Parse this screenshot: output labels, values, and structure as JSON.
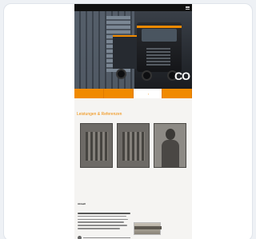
{
  "brand": {
    "logo_text": "",
    "accent": "#f08a00",
    "bar_color": "#111111"
  },
  "hero": {
    "mark_text": "CO"
  },
  "tabs": [
    {
      "label": ""
    },
    {
      "label": ""
    },
    {
      "label": ""
    },
    {
      "label": ""
    }
  ],
  "section": {
    "title": "Leistungen & Referenzen"
  },
  "gallery": [
    {
      "caption": ""
    },
    {
      "caption": ""
    },
    {
      "caption": ""
    }
  ],
  "news": {
    "label": "Aktuell"
  }
}
